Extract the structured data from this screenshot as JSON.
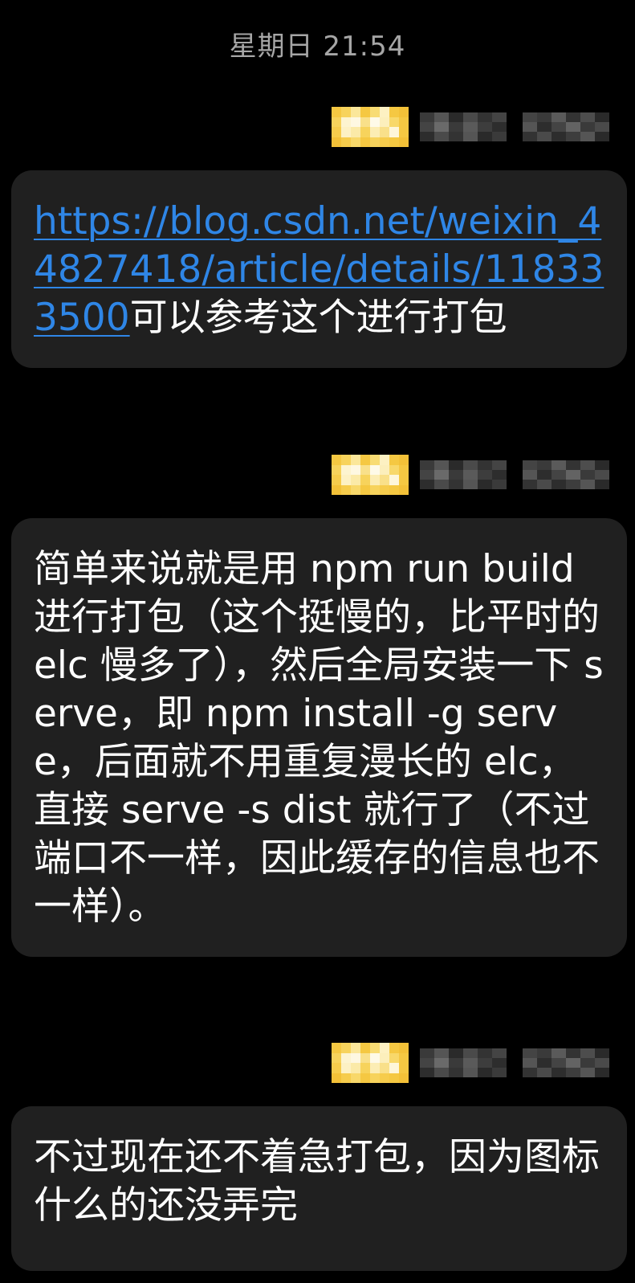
{
  "header": {
    "timestamp": "星期日 21:54"
  },
  "colors": {
    "background": "#000000",
    "bubble": "#202020",
    "link": "#2f86e6",
    "timestamp": "#a6a6a6",
    "avatar_accent": "#f5c842"
  },
  "messages": [
    {
      "link": "https://blog.csdn.net/weixin_44827418/article/details/118333500",
      "text": "可以参考这个进行打包"
    },
    {
      "text": "简单来说就是用 npm run build 进行打包（这个挺慢的，比平时的 elc 慢多了），然后全局安装一下 serve，即 npm install -g serve，后面就不用重复漫长的 elc，直接 serve -s dist 就行了（不过端口不一样，因此缓存的信息也不一样）。"
    },
    {
      "text": "不过现在还不着急打包，因为图标什么的还没弄完"
    }
  ]
}
